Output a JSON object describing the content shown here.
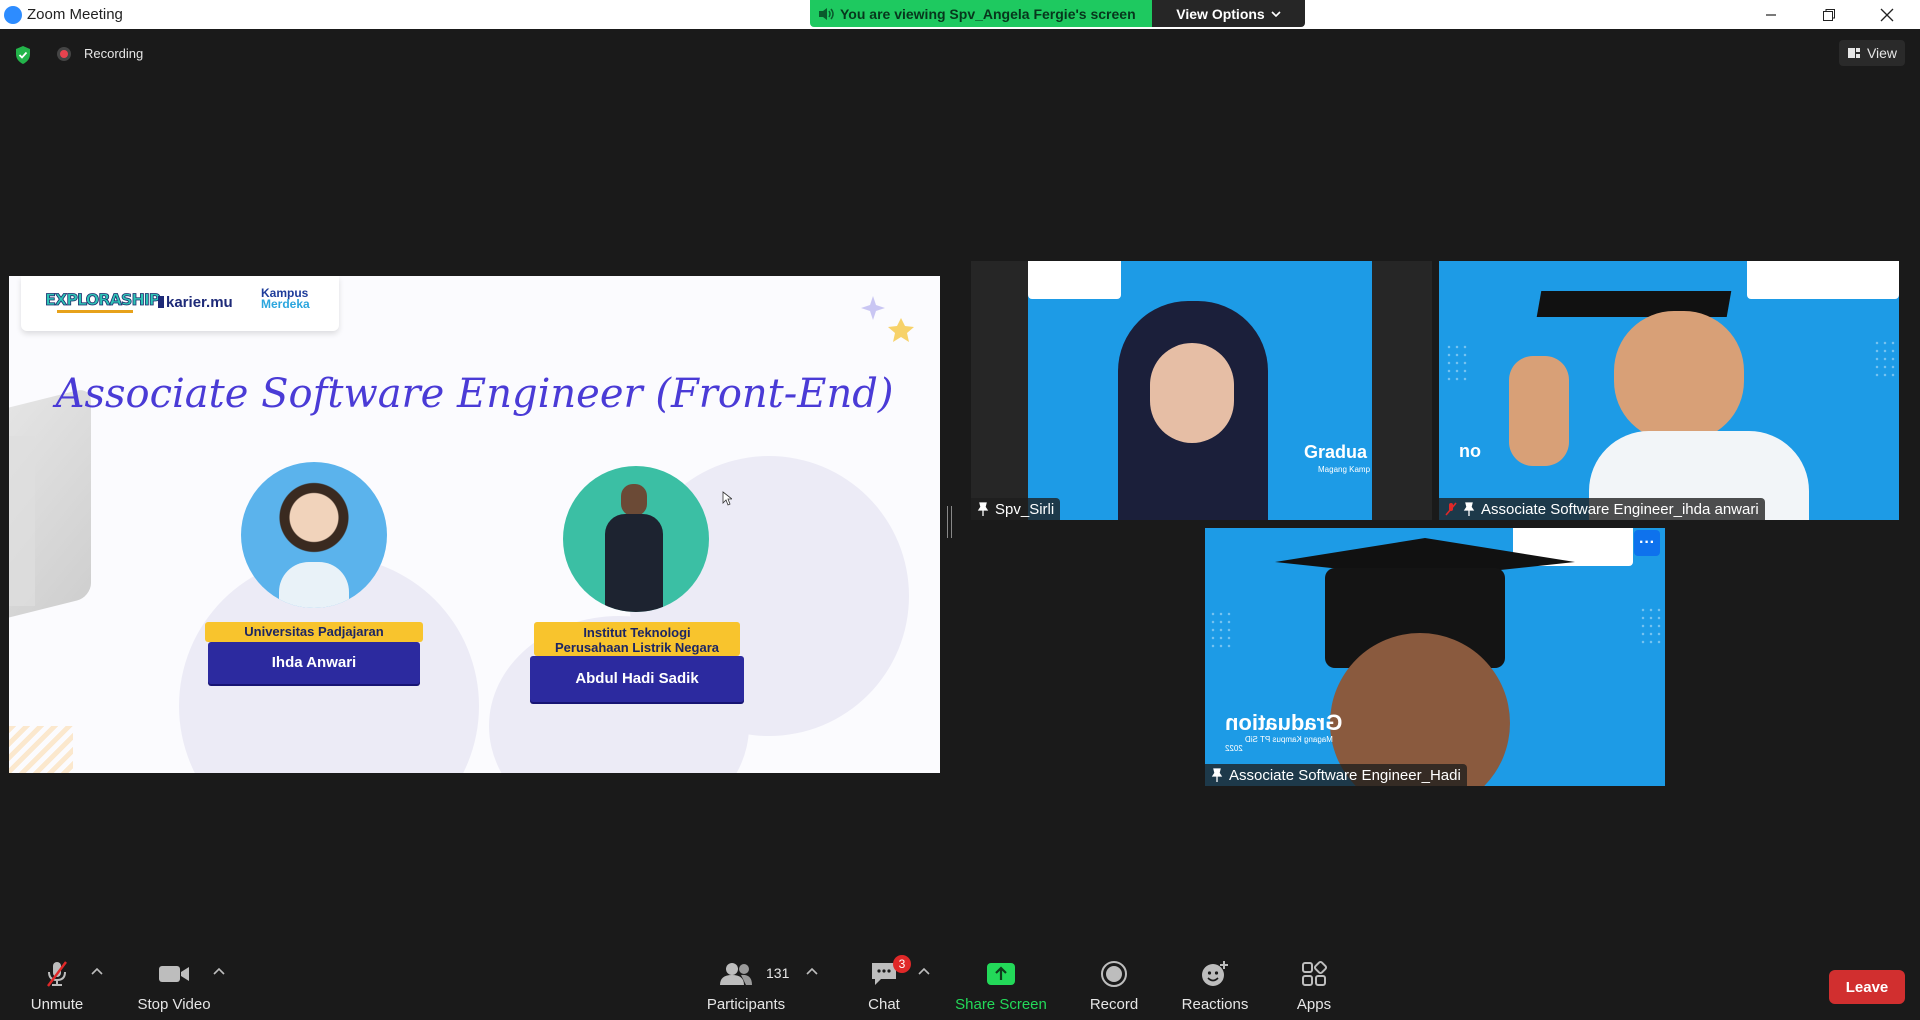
{
  "window": {
    "title": "Zoom Meeting"
  },
  "banner": {
    "viewing_text": "You are viewing Spv_Angela Fergie's screen",
    "view_options_label": "View Options"
  },
  "status": {
    "recording_label": "Recording",
    "view_label": "View"
  },
  "slide": {
    "logos": {
      "exploraship": "EXPLORASHIP",
      "kariermu": "karier.mu",
      "kampus_line1": "Kampus",
      "kampus_line2": "Merdeka"
    },
    "title": "Associate Software Engineer (Front-End)",
    "people": [
      {
        "university": "Universitas Padjajaran",
        "name": "Ihda Anwari"
      },
      {
        "university_line1": "Institut Teknologi",
        "university_line2": "Perusahaan Listrik Negara",
        "name": "Abdul Hadi Sadik"
      }
    ]
  },
  "tiles": [
    {
      "name": "Spv_Sirli",
      "watermark": "Gradua",
      "watermark_sub": "Magang Kamp"
    },
    {
      "name": "Associate Software Engineer_ihda anwari",
      "watermark": "no"
    },
    {
      "name": "Associate Software Engineer_Hadi",
      "watermark": "Graduation",
      "watermark_sub": "Magang Kampus PT SiD",
      "watermark_year": "2022",
      "more": "···"
    }
  ],
  "toolbar": {
    "unmute": "Unmute",
    "stop_video": "Stop Video",
    "participants": "Participants",
    "participants_count": "131",
    "chat": "Chat",
    "chat_badge": "3",
    "share_screen": "Share Screen",
    "record": "Record",
    "reactions": "Reactions",
    "apps": "Apps",
    "leave": "Leave"
  },
  "colors": {
    "accent_green": "#1ec960",
    "leave_red": "#d12f2f",
    "zoom_blue": "#0e72ed",
    "share_green": "#23d959",
    "slide_title": "#4a3bd6"
  }
}
